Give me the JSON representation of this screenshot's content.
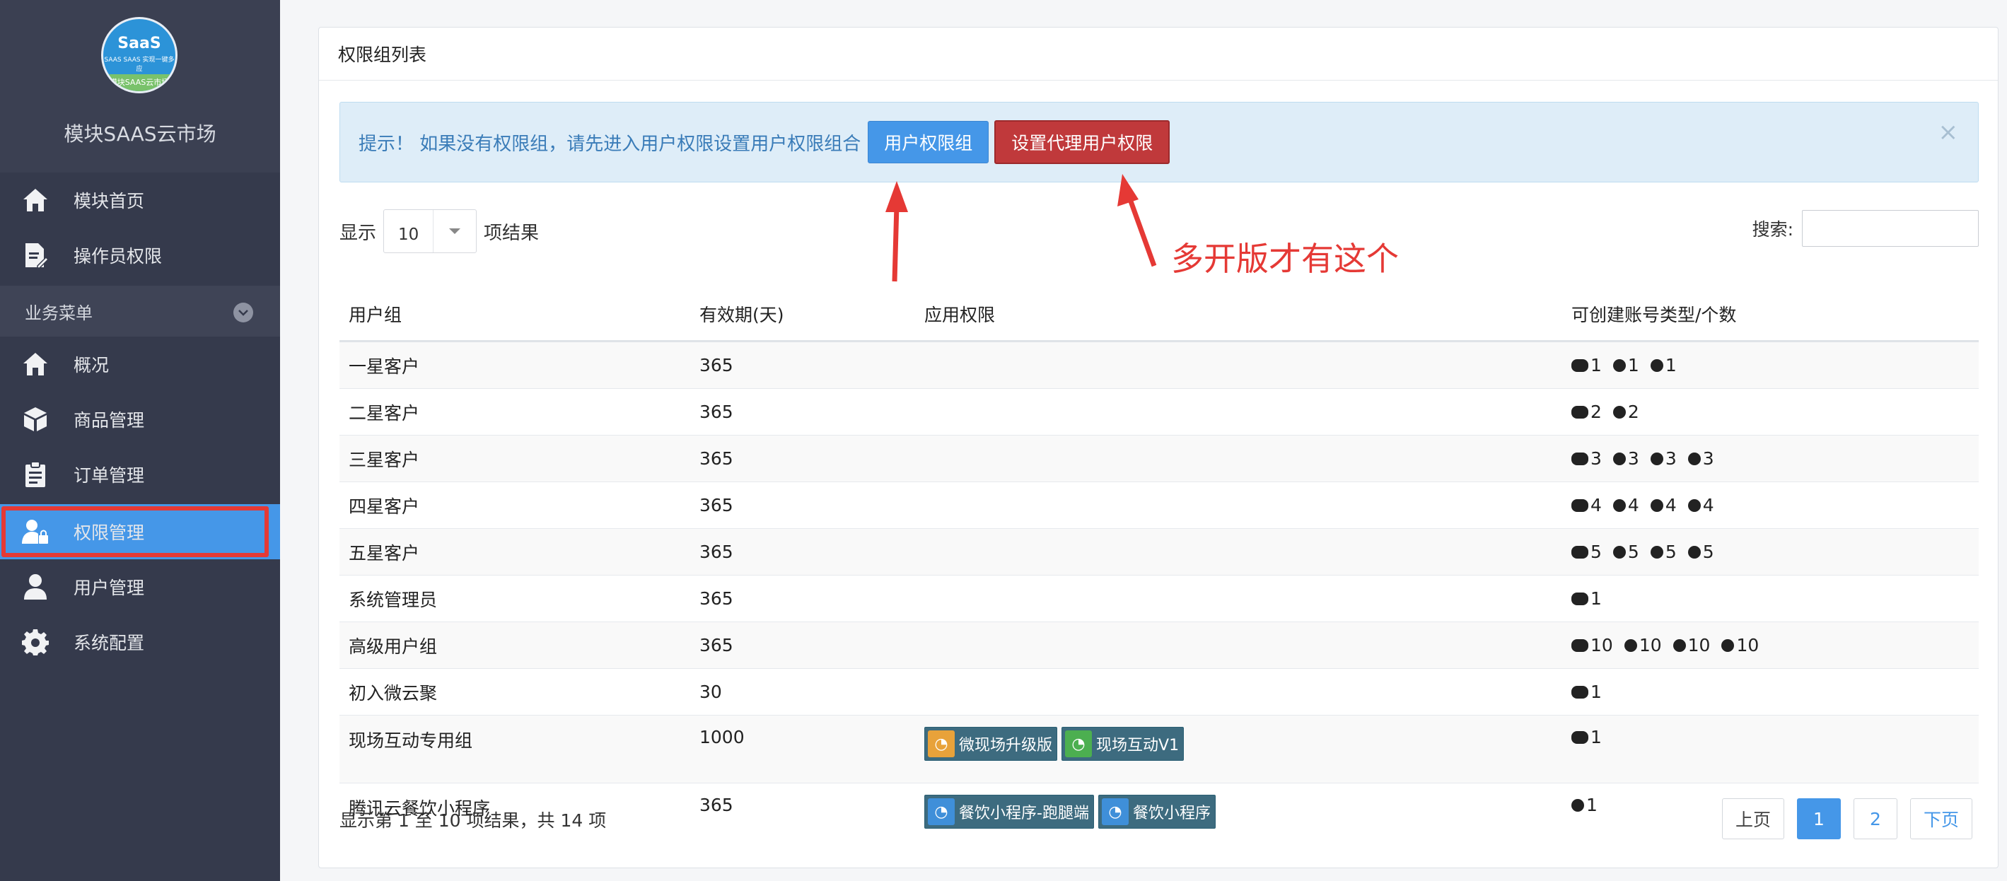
{
  "sidebar": {
    "brand": {
      "logo_text": "SaaS",
      "logo_sub": "SAAS SAAS 实现一键多应",
      "logo_band": "模块SAAS云市场",
      "title": "模块SAAS云市场"
    },
    "top_items": [
      {
        "label": "模块首页",
        "icon": "home-icon"
      },
      {
        "label": "操作员权限",
        "icon": "document-edit-icon"
      }
    ],
    "group_label": "业务菜单",
    "group_items": [
      {
        "label": "概况",
        "icon": "home-icon"
      },
      {
        "label": "商品管理",
        "icon": "box-icon"
      },
      {
        "label": "订单管理",
        "icon": "clipboard-icon"
      },
      {
        "label": "权限管理",
        "icon": "user-lock-icon",
        "active": true
      },
      {
        "label": "用户管理",
        "icon": "user-icon"
      },
      {
        "label": "系统配置",
        "icon": "gear-icon"
      }
    ]
  },
  "panel": {
    "title": "权限组列表",
    "alert": {
      "text": "提示！ 如果没有权限组，请先进入用户权限设置用户权限组合",
      "button_user_group": "用户权限组",
      "button_agent": "设置代理用户权限",
      "close": "×"
    },
    "length": {
      "prefix": "显示",
      "value": "10",
      "suffix": "项结果"
    },
    "search": {
      "label": "搜索:",
      "placeholder": ""
    },
    "columns": [
      "用户组",
      "有效期(天)",
      "应用权限",
      "可创建账号类型/个数"
    ],
    "rows": [
      {
        "group": "一星客户",
        "days": "365",
        "apps": [],
        "quota": [
          {
            "icon": "wechat",
            "n": "1"
          },
          {
            "icon": "miniapp",
            "n": "1"
          },
          {
            "icon": "circle-b",
            "n": "1"
          }
        ]
      },
      {
        "group": "二星客户",
        "days": "365",
        "apps": [],
        "quota": [
          {
            "icon": "wechat",
            "n": "2"
          },
          {
            "icon": "miniapp",
            "n": "2"
          }
        ]
      },
      {
        "group": "三星客户",
        "days": "365",
        "apps": [],
        "quota": [
          {
            "icon": "wechat",
            "n": "3"
          },
          {
            "icon": "miniapp",
            "n": "3"
          },
          {
            "icon": "circle-b",
            "n": "3"
          },
          {
            "icon": "circle-c",
            "n": "3"
          }
        ]
      },
      {
        "group": "四星客户",
        "days": "365",
        "apps": [],
        "quota": [
          {
            "icon": "wechat",
            "n": "4"
          },
          {
            "icon": "miniapp",
            "n": "4"
          },
          {
            "icon": "circle-b",
            "n": "4"
          },
          {
            "icon": "circle-c",
            "n": "4"
          }
        ]
      },
      {
        "group": "五星客户",
        "days": "365",
        "apps": [],
        "quota": [
          {
            "icon": "wechat",
            "n": "5"
          },
          {
            "icon": "miniapp",
            "n": "5"
          },
          {
            "icon": "circle-b",
            "n": "5"
          },
          {
            "icon": "circle-c",
            "n": "5"
          }
        ]
      },
      {
        "group": "系统管理员",
        "days": "365",
        "apps": [],
        "quota": [
          {
            "icon": "wechat",
            "n": "1"
          }
        ]
      },
      {
        "group": "高级用户组",
        "days": "365",
        "apps": [],
        "quota": [
          {
            "icon": "wechat",
            "n": "10"
          },
          {
            "icon": "miniapp",
            "n": "10"
          },
          {
            "icon": "circle-b",
            "n": "10"
          },
          {
            "icon": "circle-c",
            "n": "10"
          }
        ]
      },
      {
        "group": "初入微云聚",
        "days": "30",
        "apps": [],
        "quota": [
          {
            "icon": "wechat",
            "n": "1"
          }
        ]
      },
      {
        "group": "现场互动专用组",
        "days": "1000",
        "apps": [
          {
            "label": "微现场升级版",
            "color": "#e8a23a"
          },
          {
            "label": "现场互动V1",
            "color": "#4caf50"
          }
        ],
        "quota": [
          {
            "icon": "wechat",
            "n": "1"
          }
        ]
      },
      {
        "group": "腾讯云餐饮小程序",
        "days": "365",
        "apps": [
          {
            "label": "餐饮小程序-跑腿端",
            "color": "#3f8fd9"
          },
          {
            "label": "餐饮小程序",
            "color": "#3f8fd9"
          }
        ],
        "quota": [
          {
            "icon": "miniapp",
            "n": "1"
          }
        ]
      }
    ],
    "info": "显示第 1 至 10 项结果，共 14 项",
    "pager": {
      "prev": "上页",
      "pages": [
        "1",
        "2"
      ],
      "next": "下页"
    }
  },
  "annotation": {
    "text": "多开版才有这个",
    "color": "#e53935"
  },
  "colors": {
    "sidebar_bg": "#353a4c",
    "accent": "#4597e8",
    "danger": "#c0393b",
    "alert_bg": "#deedf8"
  }
}
